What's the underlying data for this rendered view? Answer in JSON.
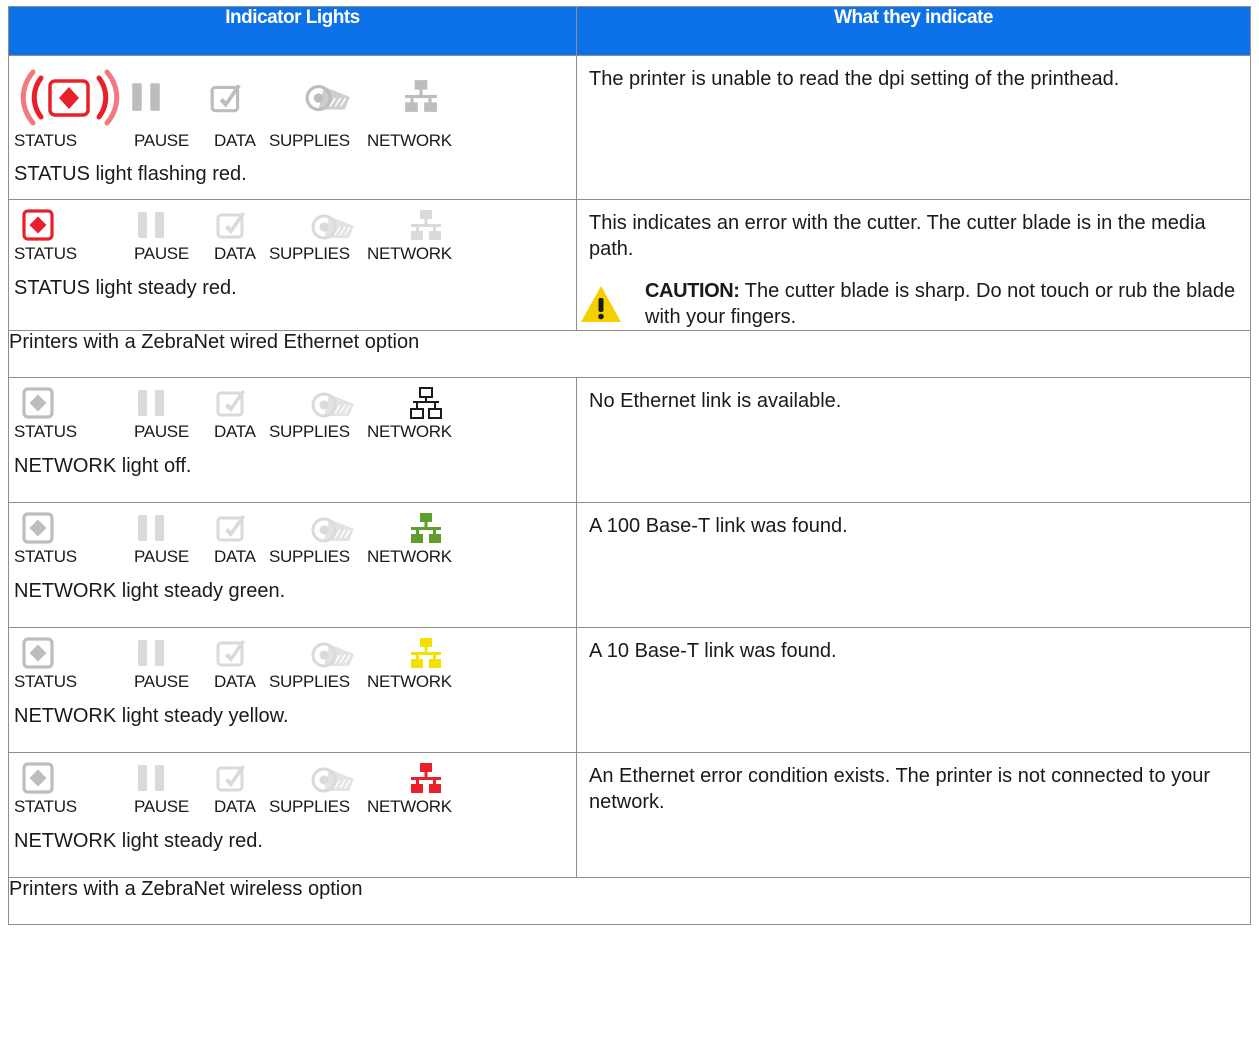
{
  "headers": {
    "indicator": "Indicator Lights",
    "meaning": "What they indicate"
  },
  "icon_labels": {
    "status": "STATUS",
    "pause": "PAUSE",
    "data": "DATA",
    "supplies": "SUPPLIES",
    "network": "NETWORK"
  },
  "colors": {
    "header_bg": "#0d72e8",
    "red": "#e8202a",
    "gray": "#bdbdbd",
    "green": "#5e9e2d",
    "yellow": "#f5e100",
    "warning": "#f6cf00"
  },
  "rows": [
    {
      "desc": "STATUS light flashing red.",
      "meaning": "The printer is unable to read the dpi setting of the printhead."
    },
    {
      "desc": "STATUS light steady red.",
      "meaning": "This indicates an error with the cutter. The cutter blade is in the media path.",
      "caution_label": "CAUTION:",
      "caution_text": " The cutter blade is sharp. Do not touch or rub the blade with your fingers.",
      "caution_icon": "warning-triangle-icon"
    },
    {
      "section": "Printers with a ZebraNet wired Ethernet option"
    },
    {
      "desc": "NETWORK light off.",
      "meaning": "No Ethernet link is available."
    },
    {
      "desc": "NETWORK light steady green.",
      "meaning": "A 100 Base-T link was found."
    },
    {
      "desc": "NETWORK light steady yellow.",
      "meaning": "A 10 Base-T link was found."
    },
    {
      "desc": "NETWORK light steady red.",
      "meaning": "An Ethernet error condition exists. The printer is not connected to your network."
    },
    {
      "section": "Printers with a ZebraNet wireless option"
    }
  ]
}
